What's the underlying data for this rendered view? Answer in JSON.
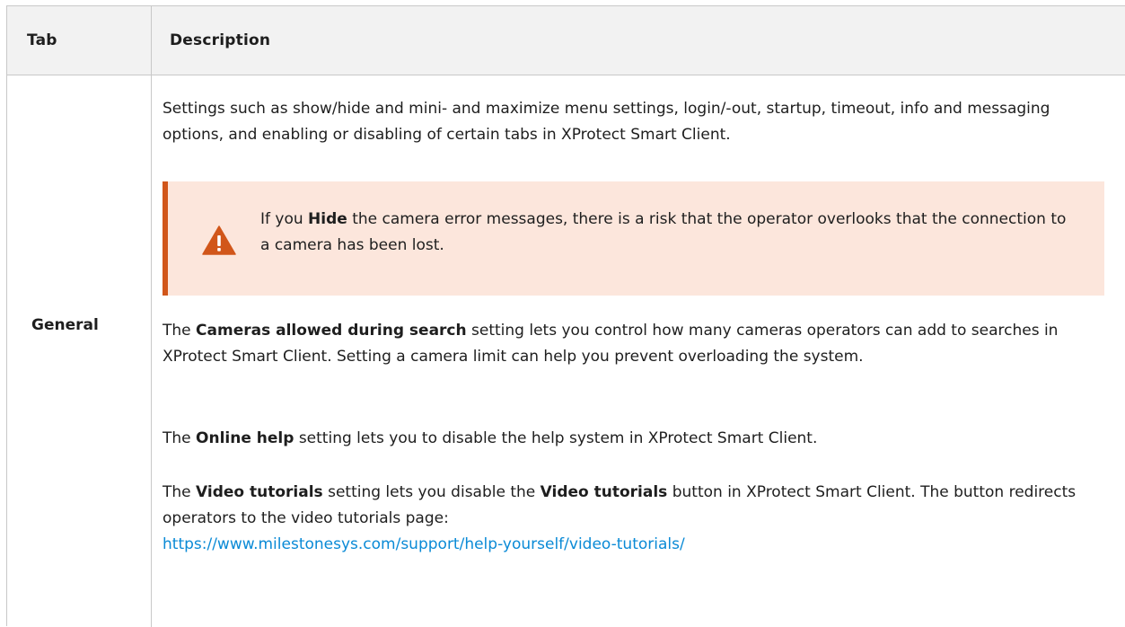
{
  "table": {
    "headers": {
      "tab": "Tab",
      "description": "Description"
    },
    "row": {
      "tab": "General",
      "para1": "Settings such as show/hide and mini- and maximize menu settings, login/-out, startup, timeout, info and messaging options, and enabling or disabling of certain tabs in XProtect Smart Client.",
      "warning": {
        "icon": "warning-triangle-icon",
        "prefix": "If you ",
        "bold": "Hide",
        "suffix": " the camera error messages, there is a risk that the operator overlooks that the connection to a camera has been lost."
      },
      "para2": {
        "prefix": "The ",
        "bold": "Cameras allowed during search",
        "suffix": " setting lets you control how many cameras operators can add to searches in XProtect Smart Client. Setting a camera limit can help you prevent overloading the system."
      },
      "para3": {
        "prefix": "The ",
        "bold": "Online help",
        "suffix": " setting lets you to disable the help system in XProtect Smart Client."
      },
      "para4": {
        "prefix": "The ",
        "bold1": "Video tutorials",
        "middle": " setting lets you disable the ",
        "bold2": "Video tutorials",
        "suffix": " button in XProtect Smart Client. The button redirects operators to the video tutorials page: ",
        "link": "https://www.milestonesys.com/support/help-yourself/video-tutorials/"
      }
    }
  },
  "colors": {
    "header_bg": "#f2f2f2",
    "border": "#c8c8c8",
    "warning_bg": "#fce6dc",
    "warning_accent": "#d1561a",
    "link": "#0a8ad6"
  }
}
